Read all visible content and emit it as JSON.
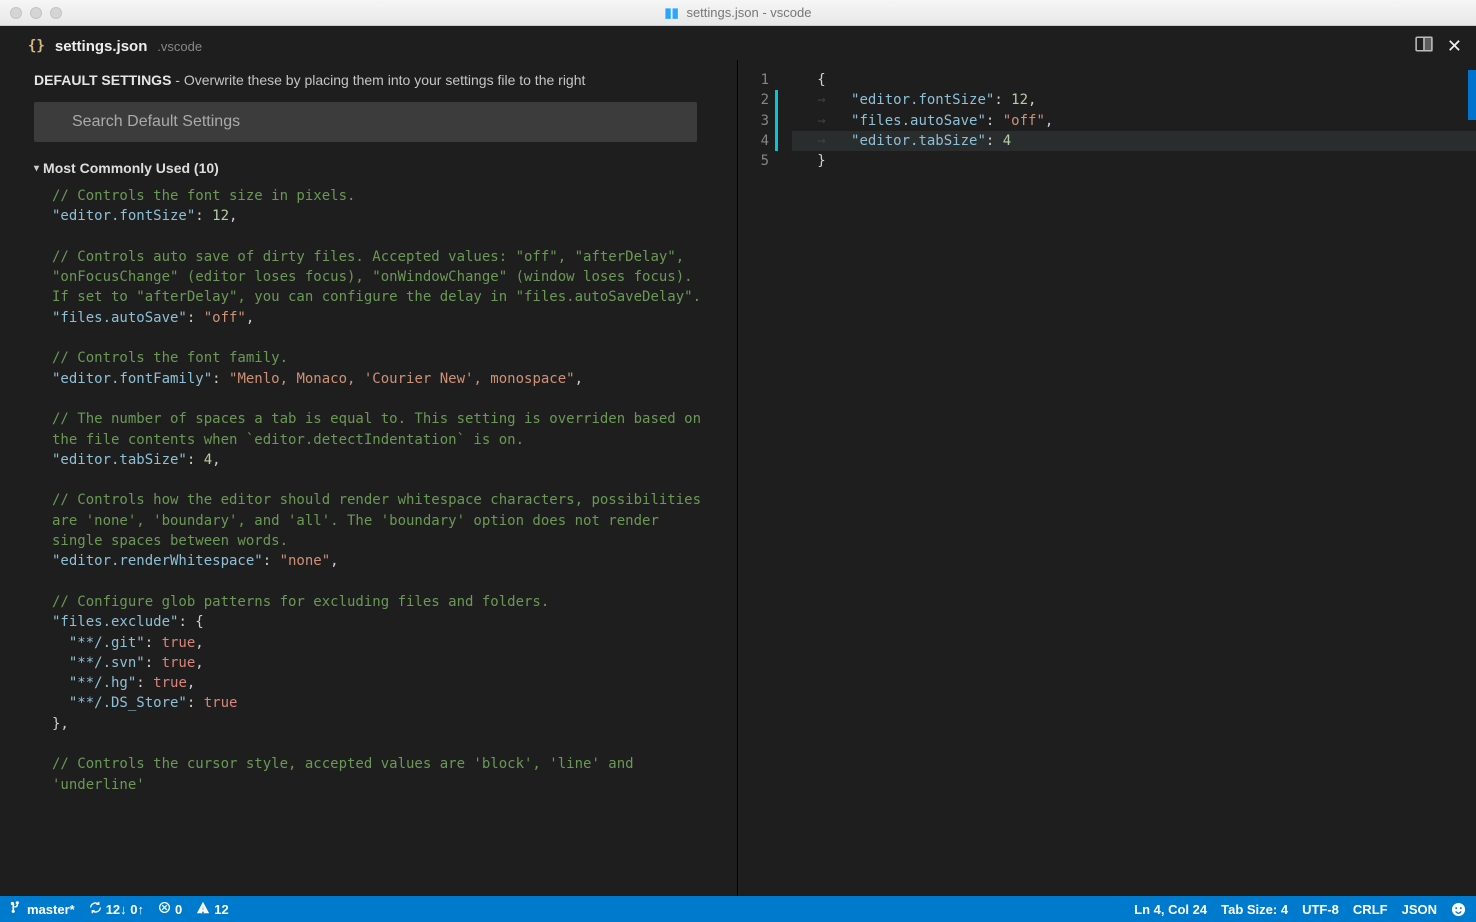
{
  "window": {
    "title_prefix": "settings.json",
    "title_suffix": " - vscode"
  },
  "tab": {
    "icon": "{}",
    "filename": "settings.json",
    "folder": ".vscode"
  },
  "leftPane": {
    "heading": "DEFAULT SETTINGS",
    "headingSub": " - Overwrite these by placing them into your settings file to the right",
    "searchPlaceholder": "Search Default Settings",
    "section": "Most Commonly Used (10)"
  },
  "defaultSettings": {
    "fontSize": {
      "comment": "// Controls the font size in pixels.",
      "key": "\"editor.fontSize\"",
      "value": "12"
    },
    "autoSave": {
      "comment": "// Controls auto save of dirty files. Accepted values:  \"off\", \"afterDelay\", \"onFocusChange\" (editor loses focus), \"onWindowChange\" (window loses focus). If set to \"afterDelay\", you can configure the delay in \"files.autoSaveDelay\".",
      "key": "\"files.autoSave\"",
      "value": "\"off\""
    },
    "fontFamily": {
      "comment": "// Controls the font family.",
      "key": "\"editor.fontFamily\"",
      "value": "\"Menlo, Monaco, 'Courier New', monospace\""
    },
    "tabSize": {
      "comment": "// The number of spaces a tab is equal to. This setting is overriden based on the file contents when `editor.detectIndentation` is on.",
      "key": "\"editor.tabSize\"",
      "value": "4"
    },
    "renderWhitespace": {
      "comment": "// Controls how the editor should render whitespace characters, possibilities are 'none', 'boundary', and 'all'. The 'boundary' option does not render single spaces between words.",
      "key": "\"editor.renderWhitespace\"",
      "value": "\"none\""
    },
    "filesExclude": {
      "comment": "// Configure glob patterns for excluding files and folders.",
      "key": "\"files.exclude\"",
      "entries": [
        {
          "key": "\"**/.git\"",
          "value": "true",
          "trail": ","
        },
        {
          "key": "\"**/.svn\"",
          "value": "true",
          "trail": ","
        },
        {
          "key": "\"**/.hg\"",
          "value": "true",
          "trail": ","
        },
        {
          "key": "\"**/.DS_Store\"",
          "value": "true",
          "trail": ""
        }
      ]
    },
    "cursorStyle": {
      "comment": "// Controls the cursor style, accepted values are 'block', 'line' and 'underline'"
    }
  },
  "editor": {
    "lines": [
      {
        "n": 1,
        "ws": "",
        "key": "",
        "sep": "{",
        "val": "",
        "trail": ""
      },
      {
        "n": 2,
        "ws": "→   ",
        "key": "\"editor.fontSize\"",
        "sep": ": ",
        "val": "12",
        "vcls": "num",
        "trail": ","
      },
      {
        "n": 3,
        "ws": "→   ",
        "key": "\"files.autoSave\"",
        "sep": ": ",
        "val": "\"off\"",
        "vcls": "str",
        "trail": ","
      },
      {
        "n": 4,
        "ws": "→   ",
        "key": "\"editor.tabSize\"",
        "sep": ": ",
        "val": "4",
        "vcls": "num",
        "trail": ""
      },
      {
        "n": 5,
        "ws": "",
        "key": "",
        "sep": "}",
        "val": "",
        "trail": ""
      }
    ]
  },
  "status": {
    "branch": "master*",
    "syncDown": "12↓",
    "syncUp": "0↑",
    "errors": "0",
    "warnings": "12",
    "lineCol": "Ln 4, Col 24",
    "tabSize": "Tab Size: 4",
    "encoding": "UTF-8",
    "eol": "CRLF",
    "lang": "JSON"
  }
}
